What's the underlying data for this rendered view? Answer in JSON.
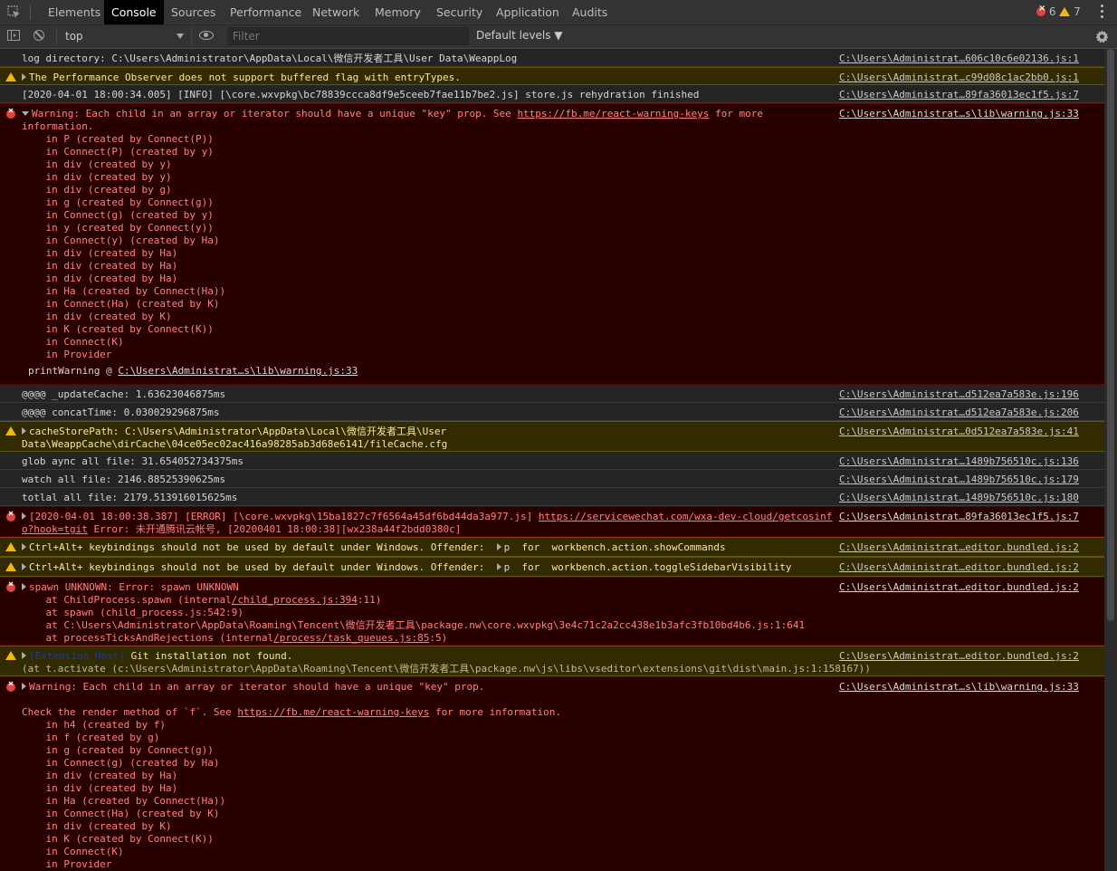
{
  "tabs": [
    "Elements",
    "Console",
    "Sources",
    "Performance",
    "Network",
    "Memory",
    "Security",
    "Application",
    "Audits"
  ],
  "active_tab": "Console",
  "counts": {
    "errors": "6",
    "warnings": "7"
  },
  "toolbar": {
    "context": "top",
    "filter_placeholder": "Filter",
    "levels": "Default levels ▼"
  },
  "messages": {
    "m1": {
      "text": "log directory: C:\\Users\\Administrator\\AppData\\Local\\微信开发者工具\\User Data\\WeappLog",
      "src": "C:\\Users\\Administrat…606c10c6e02136.js:1"
    },
    "m2": {
      "text": "The Performance Observer does not support buffered flag with entryTypes.",
      "src": "C:\\Users\\Administrat…c99d08c1ac2bb0.js:1"
    },
    "m3": {
      "text": "[2020-04-01 18:00:34.005] [INFO] [\\core.wxvpkg\\bc78839ccca8df9e5ceeb7fae11b7be2.js] store.js rehydration finished",
      "src": "C:\\Users\\Administrat…89fa36013ec1f5.js:7"
    },
    "m4": {
      "line1": "Warning: Each child in an array or iterator should have a unique \"key\" prop. See ",
      "link": "https://fb.me/react-warning-keys",
      "line1_end": " for more",
      "line2": "information.",
      "stack": "    in P (created by Connect(P))\n    in Connect(P) (created by y)\n    in div (created by y)\n    in div (created by y)\n    in div (created by g)\n    in g (created by Connect(g))\n    in Connect(g) (created by y)\n    in y (created by Connect(y))\n    in Connect(y) (created by Ha)\n    in div (created by Ha)\n    in div (created by Ha)\n    in div (created by Ha)\n    in Ha (created by Connect(Ha))\n    in Connect(Ha) (created by K)\n    in div (created by K)\n    in K (created by Connect(K))\n    in Connect(K)\n    in Provider",
      "print": "printWarning @ ",
      "print_link": "C:\\Users\\Administrat…s\\lib\\warning.js:33",
      "src": "C:\\Users\\Administrat…s\\lib\\warning.js:33"
    },
    "m5": {
      "text": "@@@@ _updateCache: 1.63623046875ms",
      "src": "C:\\Users\\Administrat…d512ea7a583e.js:196"
    },
    "m6": {
      "text": "@@@@ concatTime: 0.030029296875ms",
      "src": "C:\\Users\\Administrat…d512ea7a583e.js:206"
    },
    "m7": {
      "text": "cacheStorePath: C:\\Users\\Administrator\\AppData\\Local\\微信开发者工具\\User\nData\\WeappCache\\dirCache\\04ce05ec02ac416a98285ab3d68e6141/fileCache.cfg",
      "src": "C:\\Users\\Administrat…0d512ea7a583e.js:41"
    },
    "m8": {
      "text": "glob aync all file: 31.654052734375ms",
      "src": "C:\\Users\\Administrat…1489b756510c.js:136"
    },
    "m9": {
      "text": "watch all file: 2146.88525390625ms",
      "src": "C:\\Users\\Administrat…1489b756510c.js:179"
    },
    "m10": {
      "text": "totlal all file: 2179.513916015625ms",
      "src": "C:\\Users\\Administrat…1489b756510c.js:180"
    },
    "m11": {
      "text1": "[2020-04-01 18:00:38.387] [ERROR] [\\core.wxvpkg\\15ba1827c7f6564a45df6bd44da3a977.js] ",
      "link1": "https://servicewechat.com/wxa-dev-cloud/getcosinf",
      "link2": "o?hook=tgit",
      "text2": " Error: 未开通腾讯云帐号, [20200401 18:00:38][wx238a44f2bdd0380c]",
      "src": "C:\\Users\\Administrat…89fa36013ec1f5.js:7"
    },
    "m12": {
      "text": "Ctrl+Alt+ keybindings should not be used by default under Windows. Offender: ",
      "obj": "p",
      "tail": "  for  workbench.action.showCommands",
      "src": "C:\\Users\\Administrat…editor.bundled.js:2"
    },
    "m13": {
      "text": "Ctrl+Alt+ keybindings should not be used by default under Windows. Offender: ",
      "obj": "p",
      "tail": "  for  workbench.action.toggleSidebarVisibility",
      "src": "C:\\Users\\Administrat…editor.bundled.js:2"
    },
    "m14": {
      "text": "spawn UNKNOWN: Error: spawn UNKNOWN",
      "l1a": "    at ChildProcess.spawn (internal",
      "l1b": "/child_process.js:394",
      "l1c": ":11)",
      "l2": "    at spawn (child_process.js:542:9)",
      "l3": "    at C:\\Users\\Administrator\\AppData\\Roaming\\Tencent\\微信开发者工具\\package.nw\\core.wxvpkg\\3e4c71c2a2cc438e1b3afc3fb10bd4b6.js:1:641",
      "l4a": "    at processTicksAndRejections (internal",
      "l4b": "/process/task_queues.js:85",
      "l4c": ":5)",
      "src": "C:\\Users\\Administrat…editor.bundled.js:2"
    },
    "m15": {
      "tag": "[Extension Host]",
      "text": " Git installation not found.",
      "line2": "(at t.activate (c:\\Users\\Administrator\\AppData\\Roaming\\Tencent\\微信开发者工具\\package.nw\\js\\libs\\vseditor\\extensions\\git\\dist\\main.js:1:158167))",
      "src": "C:\\Users\\Administrat…editor.bundled.js:2"
    },
    "m16": {
      "line1": "Warning: Each child in an array or iterator should have a unique \"key\" prop.",
      "line2a": "Check the render method of `f`. See ",
      "link": "https://fb.me/react-warning-keys",
      "line2b": " for more information.",
      "stack": "    in h4 (created by f)\n    in f (created by g)\n    in g (created by Connect(g))\n    in Connect(g) (created by Ha)\n    in div (created by Ha)\n    in div (created by Ha)\n    in Ha (created by Connect(Ha))\n    in Connect(Ha) (created by K)\n    in div (created by K)\n    in K (created by Connect(K))\n    in Connect(K)\n    in Provider",
      "src": "C:\\Users\\Administrat…s\\lib\\warning.js:33"
    }
  }
}
